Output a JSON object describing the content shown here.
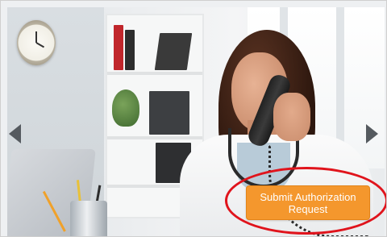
{
  "slide": {
    "image": "photo of a smiling healthcare worker talking on a phone at a desk",
    "cta_label": "Submit Authorization Request",
    "prev_icon": "triangle-left-icon",
    "next_icon": "triangle-right-icon",
    "highlight_color": "#e0141c",
    "cta_color": "#f4972d",
    "arrow_color": "#555a5f"
  }
}
